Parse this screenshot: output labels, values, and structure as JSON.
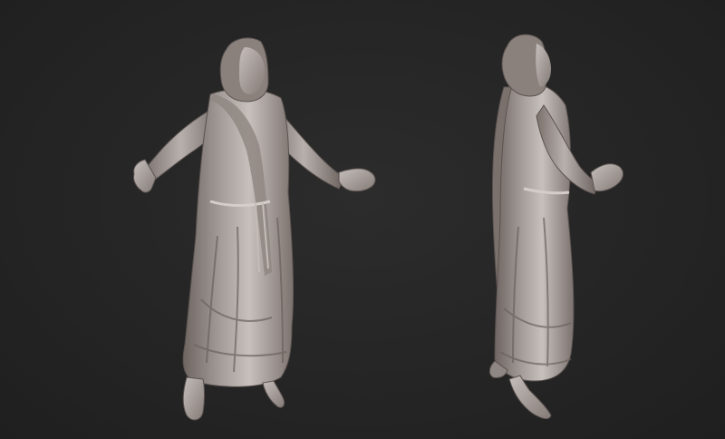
{
  "scene": {
    "background_color": "#262626",
    "material_color": "#a7a09c",
    "shadow_color": "#6f6662",
    "highlight_color": "#d9d3cf",
    "views": [
      {
        "name": "front-view",
        "description_icon": "sculpture-figure-front"
      },
      {
        "name": "side-view",
        "description_icon": "sculpture-figure-side"
      }
    ]
  }
}
